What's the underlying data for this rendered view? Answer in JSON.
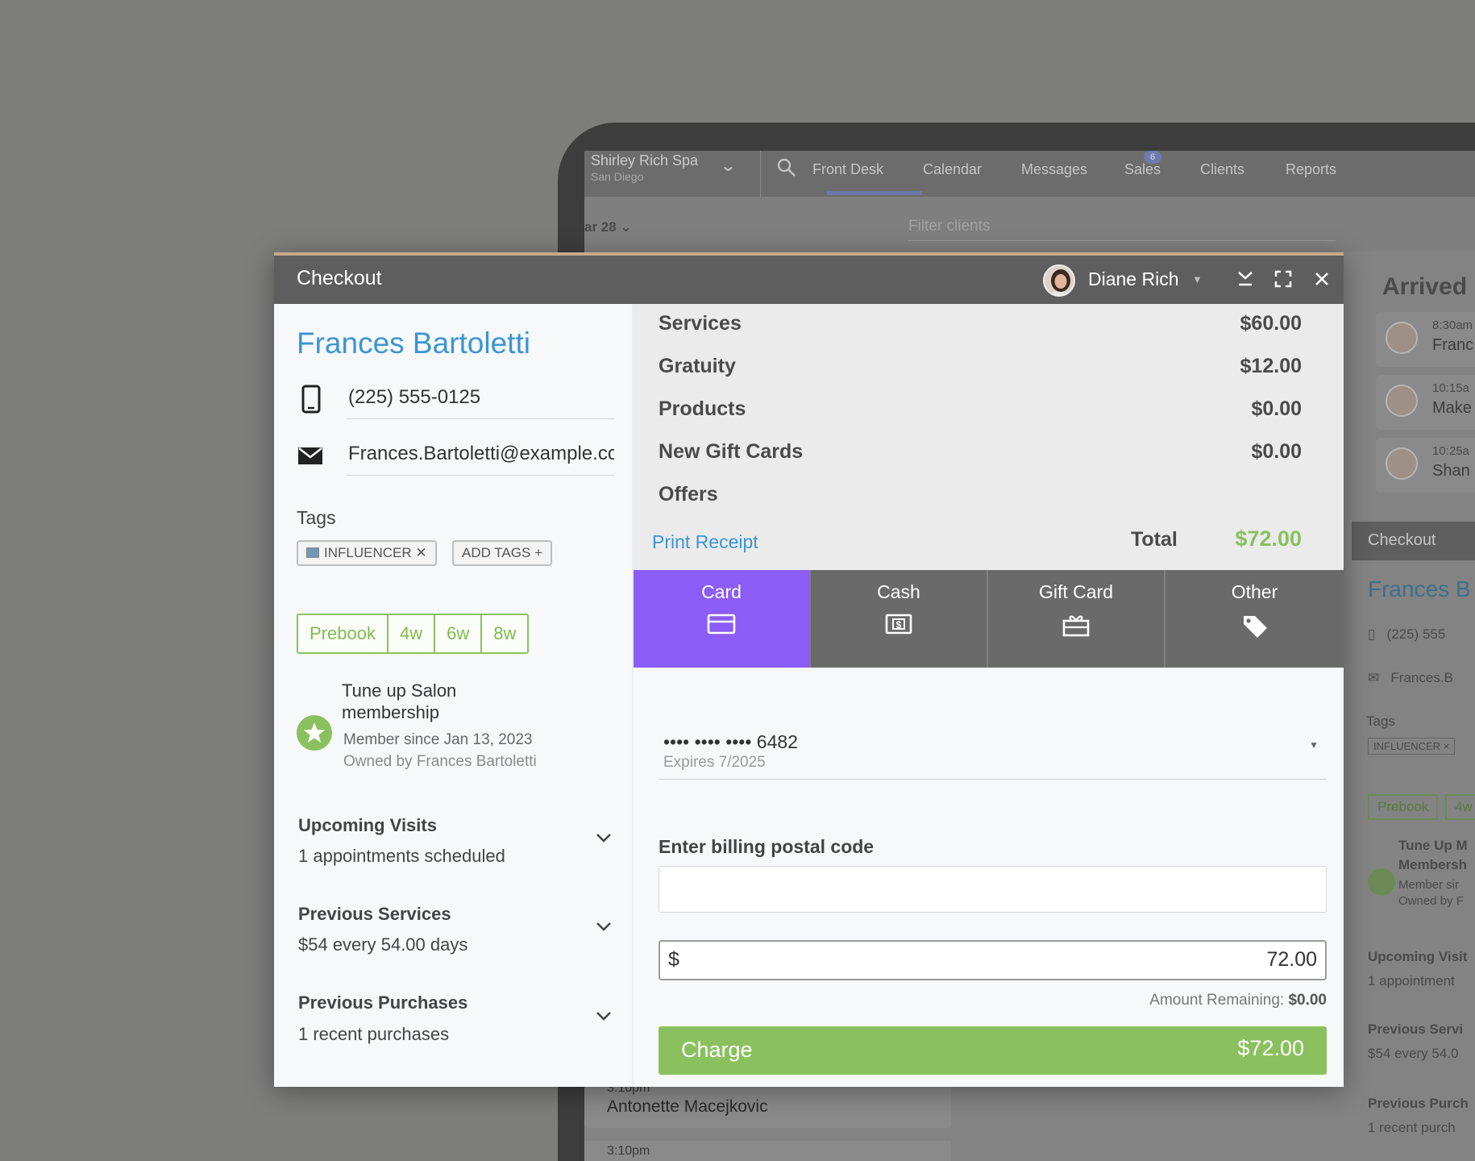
{
  "background": {
    "business_name": "Shirley Rich Spa",
    "business_city": "San Diego",
    "nav": [
      "Front Desk",
      "Calendar",
      "Messages",
      "Sales",
      "Clients",
      "Reports"
    ],
    "messages_badge": "6",
    "date_label": "ar 28",
    "filter_placeholder": "Filter clients",
    "arrived_title": "Arrived",
    "arrived": [
      {
        "time": "8:30am",
        "name": "Franc"
      },
      {
        "time": "10:15a",
        "name": "Make"
      },
      {
        "time": "10:25a",
        "name": "Shan"
      }
    ],
    "mini": {
      "title": "Checkout",
      "client": "Frances B",
      "phone": "(225) 555",
      "email": "Frances.B",
      "tags_label": "Tags",
      "tag": "INFLUENCER ×",
      "prebook": "Prebook",
      "prebook_4w": "4w",
      "membership_1": "Tune Up M",
      "membership_2": "Membersh",
      "membership_3": "Member sir",
      "membership_4": "Owned by F",
      "upcoming": "Upcoming Visit",
      "upcoming_sub": "1 appointment",
      "prev_services": "Previous Servi",
      "prev_services_sub": "$54 every 54.0",
      "prev_purchases": "Previous Purch",
      "prev_purchases_sub": "1 recent purch"
    },
    "bottom_rows": [
      {
        "time": "3:10pm",
        "name": "Antonette Macejkovic"
      },
      {
        "time": "3:10pm",
        "name": ""
      }
    ]
  },
  "modal": {
    "title": "Checkout",
    "staff_name": "Diane Rich",
    "client": {
      "name": "Frances Bartoletti",
      "phone": "(225) 555-0125",
      "email": "Frances.Bartoletti@example.com"
    },
    "tags_label": "Tags",
    "tags": [
      "INFLUENCER"
    ],
    "add_tags_label": "ADD TAGS",
    "prebook": [
      "Prebook",
      "4w",
      "6w",
      "8w"
    ],
    "membership": {
      "title": "Tune up Salon membership",
      "since": "Member since Jan 13, 2023",
      "owner": "Owned by Frances Bartoletti"
    },
    "accordions": [
      {
        "title": "Upcoming Visits",
        "subtitle": "1 appointments scheduled"
      },
      {
        "title": "Previous Services",
        "subtitle": "$54 every 54.00 days"
      },
      {
        "title": "Previous Purchases",
        "subtitle": "1 recent purchases"
      }
    ],
    "summary": [
      {
        "label": "Services",
        "value": "$60.00"
      },
      {
        "label": "Gratuity",
        "value": "$12.00"
      },
      {
        "label": "Products",
        "value": "$0.00"
      },
      {
        "label": "New Gift Cards",
        "value": "$0.00"
      },
      {
        "label": "Offers",
        "value": ""
      }
    ],
    "print_receipt": "Print Receipt",
    "total_label": "Total",
    "total_value": "$72.00",
    "payment_tabs": [
      "Card",
      "Cash",
      "Gift Card",
      "Other"
    ],
    "active_payment_tab": "Card",
    "card": {
      "number": "•••• •••• •••• 6482",
      "expiry": "Expires 7/2025"
    },
    "postal_label": "Enter billing postal code",
    "postal_value": "",
    "amount_currency": "$",
    "amount_value": "72.00",
    "amount_remaining_label": "Amount Remaining:",
    "amount_remaining_value": "$0.00",
    "charge_label": "Charge",
    "charge_amount": "$72.00"
  },
  "colors": {
    "accent_purple": "#8b5cf6",
    "accent_green": "#8ac15e",
    "link_blue": "#3b95d3"
  }
}
